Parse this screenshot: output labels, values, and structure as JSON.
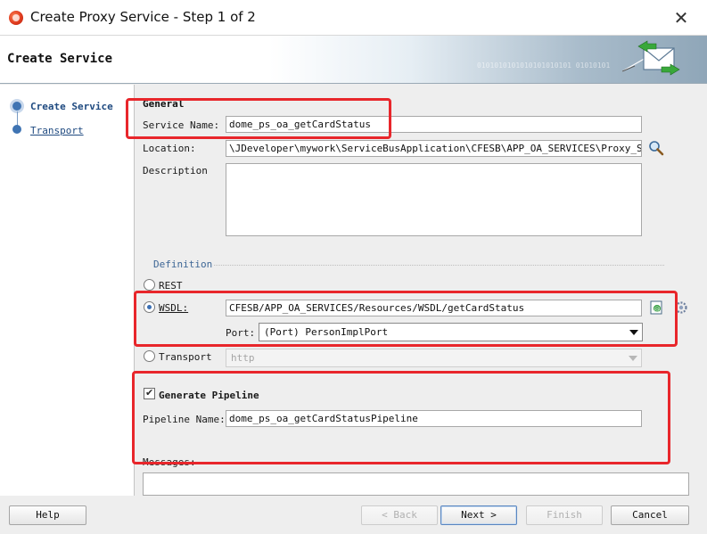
{
  "window": {
    "title": "Create Proxy Service - Step 1 of 2",
    "close_glyph": "✕"
  },
  "banner": {
    "title": "Create Service",
    "binary_text": "0101010101010101010101 01010101"
  },
  "sidebar": {
    "steps": [
      {
        "label": "Create Service",
        "active": true
      },
      {
        "label": "Transport",
        "active": false
      }
    ]
  },
  "general": {
    "section_title": "General",
    "service_name": {
      "label": "Service Name:",
      "value": "dome_ps_oa_getCardStatus"
    },
    "location": {
      "label": "Location:",
      "value": "\\JDeveloper\\mywork\\ServiceBusApplication\\CFESB\\APP_OA_SERVICES\\Proxy_Services"
    },
    "description": {
      "label": "Description",
      "value": ""
    }
  },
  "definition": {
    "section_title": "Definition",
    "rest": {
      "label": "REST",
      "selected": false
    },
    "wsdl": {
      "label": "WSDL:",
      "selected": true,
      "value": "CFESB/APP_OA_SERVICES/Resources/WSDL/getCardStatus"
    },
    "port": {
      "label": "Port:",
      "value": "(Port) PersonImplPort"
    },
    "transport": {
      "label": "Transport",
      "selected": false,
      "value": "http"
    }
  },
  "pipeline": {
    "generate_label": "Generate Pipeline",
    "checked": true,
    "name_label": "Pipeline Name:",
    "name_value": "dome_ps_oa_getCardStatusPipeline"
  },
  "messages": {
    "label": "Messages:",
    "value": ""
  },
  "footer": {
    "help": "Help",
    "back": "< Back",
    "next": "Next >",
    "finish": "Finish",
    "cancel": "Cancel"
  },
  "colors": {
    "highlight": "#e8262b",
    "accent": "#3b6fb4"
  }
}
